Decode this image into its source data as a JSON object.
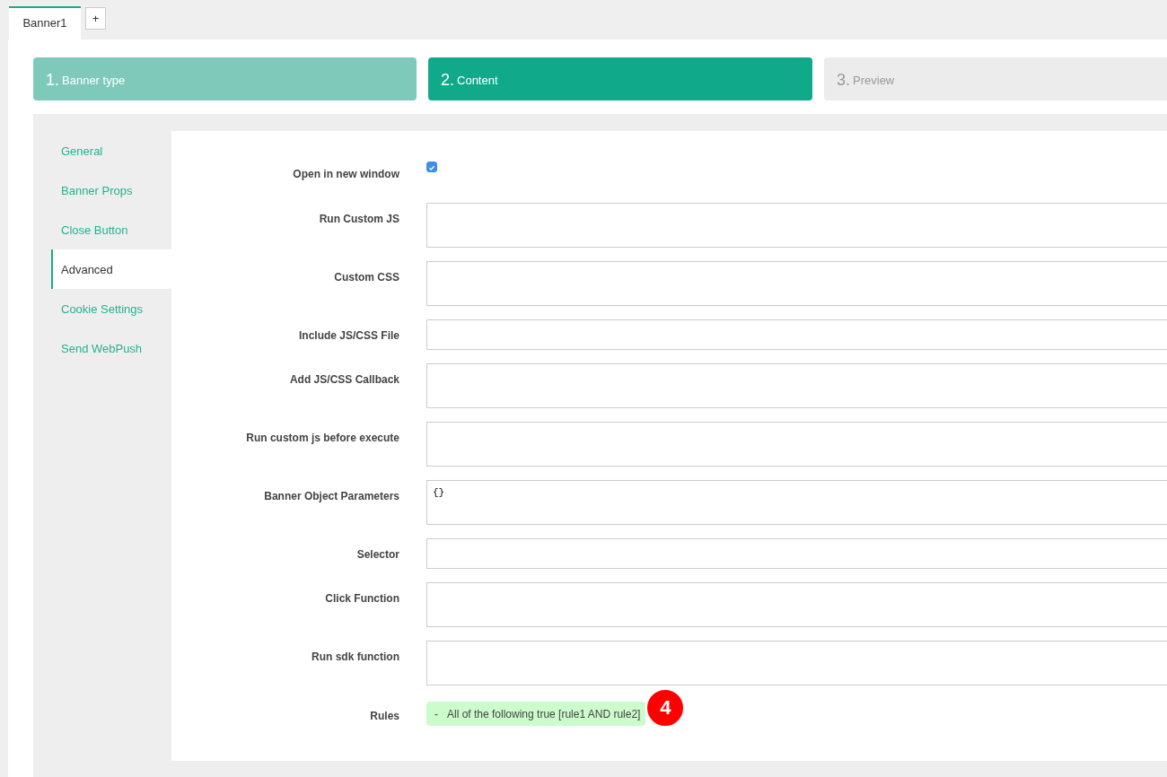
{
  "tabs": [
    {
      "label": "Banner1",
      "selected": true
    }
  ],
  "add_tab": {
    "label": "+"
  },
  "steps": [
    {
      "number": "1.",
      "label": "Banner type",
      "selected": false
    },
    {
      "number": "2.",
      "label": "Content",
      "selected": true
    },
    {
      "number": "3.",
      "label": "Preview",
      "selected": false
    }
  ],
  "sidebar": {
    "items": [
      {
        "label": "General",
        "selected": false
      },
      {
        "label": "Banner Props",
        "selected": false
      },
      {
        "label": "Close Button",
        "selected": false
      },
      {
        "label": "Advanced",
        "selected": true
      },
      {
        "label": "Cookie Settings",
        "selected": false
      },
      {
        "label": "Send WebPush",
        "selected": false
      }
    ]
  },
  "form": [
    {
      "kind": "checkbox",
      "label": "Open in new window",
      "checked": true
    },
    {
      "kind": "textarea",
      "label": "Run Custom JS"
    },
    {
      "kind": "textarea",
      "label": "Custom CSS"
    },
    {
      "kind": "input",
      "label": "Include JS/CSS File"
    },
    {
      "kind": "textarea",
      "label": "Add JS/CSS Callback"
    },
    {
      "kind": "textarea",
      "label": "Run custom js before execute"
    },
    {
      "kind": "textarea",
      "label": "Banner Object Parameters",
      "value": "{}"
    },
    {
      "kind": "input",
      "label": "Selector"
    },
    {
      "kind": "textarea",
      "label": "Click Function"
    },
    {
      "kind": "textarea",
      "label": "Run sdk function"
    },
    {
      "kind": "rules",
      "label": "Rules",
      "toggle": "-",
      "rule": "All of the following true [rule1 AND rule2]",
      "count": "4"
    }
  ]
}
